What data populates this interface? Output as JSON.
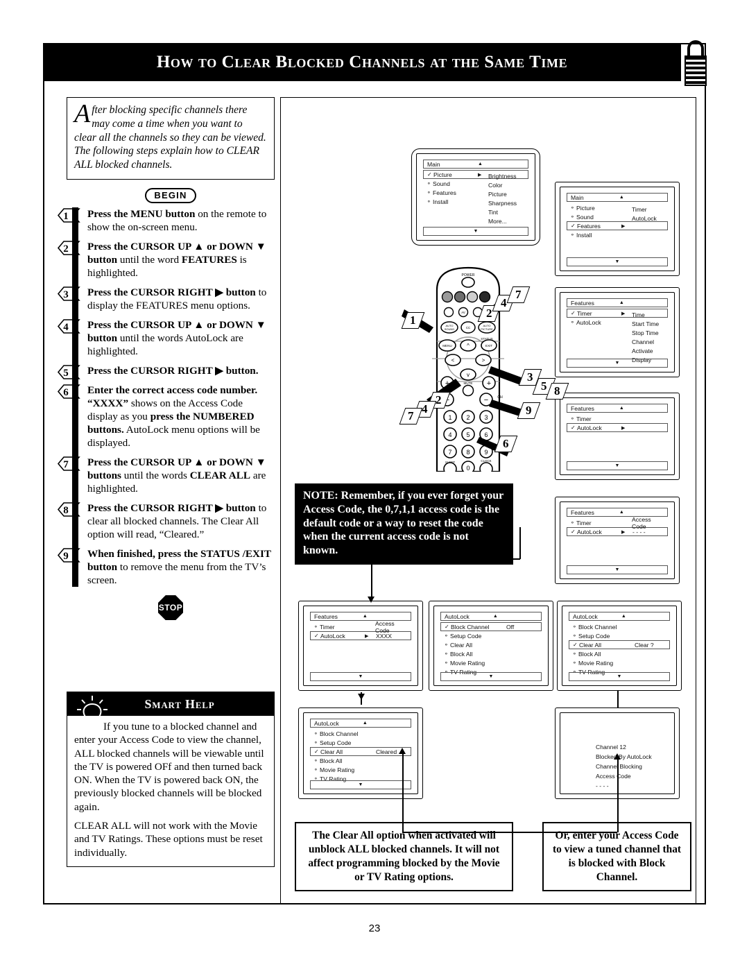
{
  "page": {
    "title": "How to Clear Blocked Channels at the Same Time",
    "number": "23",
    "padlock_icon": "open-padlock-icon"
  },
  "intro": {
    "dropcap": "A",
    "text": "fter blocking specific channels there may come a time when you want to clear all the channels so they can be viewed. The following steps explain how to CLEAR ALL blocked channels.",
    "begin_label": "BEGIN",
    "stop_label": "STOP"
  },
  "steps": [
    {
      "num": "1",
      "html": "<b>Press the MENU button</b> on the remote to show the on-screen menu."
    },
    {
      "num": "2",
      "html": "<b>Press the CURSOR UP ▲ or DOWN ▼ button</b> until the word <b>FEATURES</b> is highlighted."
    },
    {
      "num": "3",
      "html": "<b>Press the CURSOR RIGHT ▶ button</b> to display the FEATURES menu options."
    },
    {
      "num": "4",
      "html": "<b>Press the CURSOR UP ▲ or DOWN ▼ button</b> until the words AutoLock are highlighted."
    },
    {
      "num": "5",
      "html": "<b>Press the CURSOR RIGHT ▶ button.</b>"
    },
    {
      "num": "6",
      "html": "<b>Enter the correct access code number. “XXXX”</b> shows on the Access Code display as you <b>press the NUMBERED buttons.</b> AutoLock menu options will be displayed."
    },
    {
      "num": "7",
      "html": "<b>Press the CURSOR UP ▲ or DOWN ▼ buttons</b> until the words <b>CLEAR ALL</b> are highlighted."
    },
    {
      "num": "8",
      "html": "<b>Press the CURSOR RIGHT ▶ button</b> to clear all blocked channels. The Clear All option will read, “Cleared.”"
    },
    {
      "num": "9",
      "html": "<b>When finished, press the STATUS /EXIT button</b> to remove the menu from the TV’s screen."
    }
  ],
  "smart_help": {
    "title": "Smart Help",
    "icon": "lightbulb-icon",
    "paragraphs": [
      "If you tune to a blocked channel and enter your Access Code to view the channel, ALL blocked channels will be viewable until the TV is powered OFf and then turned back ON. When the TV is powered back ON, the previously blocked channels will be blocked again.",
      "CLEAR ALL will not work with the Movie and TV Ratings. These options must be reset individually."
    ]
  },
  "note": {
    "text": "NOTE: Remember, if you ever forget your Access Code, the 0,7,1,1 access code is the default code or a way to reset the code when the current access code is not known."
  },
  "captions": [
    {
      "text": "The Clear All option when activated will unblock ALL blocked channels. It will not affect programming blocked by the Movie or TV Rating options."
    },
    {
      "text": "Or, enter your Access Code to view a tuned channel that is blocked with Block Channel."
    }
  ],
  "screens": {
    "s1_main_picture": {
      "title": "Main",
      "rows": [
        {
          "bullet": "✓",
          "label": "Picture",
          "arrow": "▶",
          "boxed": true
        },
        {
          "bullet": "⚬",
          "label": "Sound",
          "arrow": "",
          "boxed": false
        },
        {
          "bullet": "⚬",
          "label": "Features",
          "arrow": "",
          "boxed": false
        },
        {
          "bullet": "⚬",
          "label": "Install",
          "arrow": "",
          "boxed": false
        }
      ],
      "column": [
        "Brightness",
        "Color",
        "Picture",
        "Sharpness",
        "Tint",
        "More..."
      ]
    },
    "s2_main_features": {
      "title": "Main",
      "rows": [
        {
          "bullet": "⚬",
          "label": "Picture",
          "arrow": "",
          "boxed": false
        },
        {
          "bullet": "⚬",
          "label": "Sound",
          "arrow": "",
          "boxed": false
        },
        {
          "bullet": "✓",
          "label": "Features",
          "arrow": "▶",
          "boxed": true
        },
        {
          "bullet": "⚬",
          "label": "Install",
          "arrow": "",
          "boxed": false
        }
      ],
      "column": [
        "Timer",
        "AutoLock"
      ]
    },
    "s3_features_timer": {
      "title": "Features",
      "rows": [
        {
          "bullet": "✓",
          "label": "Timer",
          "arrow": "▶",
          "boxed": true
        },
        {
          "bullet": "⚬",
          "label": "AutoLock",
          "arrow": "",
          "boxed": false
        }
      ],
      "column": [
        "Time",
        "Start Time",
        "Stop Time",
        "Channel",
        "Activate",
        "Display"
      ]
    },
    "s4_features_autolock": {
      "title": "Features",
      "rows": [
        {
          "bullet": "⚬",
          "label": "Timer",
          "arrow": "",
          "boxed": false
        },
        {
          "bullet": "✓",
          "label": "AutoLock",
          "arrow": "▶",
          "boxed": true
        }
      ],
      "column": []
    },
    "s5_access_code_blank": {
      "title": "Features",
      "rows": [
        {
          "bullet": "⚬",
          "label": "Timer",
          "arrow": "",
          "value": "Access Code",
          "boxed": false
        },
        {
          "bullet": "✓",
          "label": "AutoLock",
          "arrow": "▶",
          "value": "- - - -",
          "boxed": true
        }
      ],
      "column": []
    },
    "s6_access_code_xxxx": {
      "title": "Features",
      "rows": [
        {
          "bullet": "⚬",
          "label": "Timer",
          "arrow": "",
          "value": "Access Code",
          "boxed": false
        },
        {
          "bullet": "✓",
          "label": "AutoLock",
          "arrow": "▶",
          "value": "XXXX",
          "boxed": true
        }
      ],
      "column": []
    },
    "s7_autolock_block_channel": {
      "title": "AutoLock",
      "rows": [
        {
          "bullet": "✓",
          "label": "Block Channel",
          "arrow": "",
          "value": "Off",
          "boxed": true
        },
        {
          "bullet": "⚬",
          "label": "Setup Code",
          "arrow": "",
          "boxed": false
        },
        {
          "bullet": "⚬",
          "label": "Clear All",
          "arrow": "",
          "boxed": false
        },
        {
          "bullet": "⚬",
          "label": "Block All",
          "arrow": "",
          "boxed": false
        },
        {
          "bullet": "⚬",
          "label": "Movie Rating",
          "arrow": "",
          "boxed": false
        },
        {
          "bullet": "⚬",
          "label": "TV Rating",
          "arrow": "",
          "boxed": false
        }
      ],
      "column": []
    },
    "s8_autolock_clear_q": {
      "title": "AutoLock",
      "rows": [
        {
          "bullet": "⚬",
          "label": "Block Channel",
          "arrow": "",
          "boxed": false
        },
        {
          "bullet": "⚬",
          "label": "Setup Code",
          "arrow": "",
          "boxed": false
        },
        {
          "bullet": "✓",
          "label": "Clear All",
          "arrow": "",
          "value": "Clear ?",
          "boxed": true
        },
        {
          "bullet": "⚬",
          "label": "Block All",
          "arrow": "",
          "boxed": false
        },
        {
          "bullet": "⚬",
          "label": "Movie Rating",
          "arrow": "",
          "boxed": false
        },
        {
          "bullet": "⚬",
          "label": "TV Rating",
          "arrow": "",
          "boxed": false
        }
      ],
      "column": []
    },
    "s9_autolock_cleared": {
      "title": "AutoLock",
      "rows": [
        {
          "bullet": "⚬",
          "label": "Block Channel",
          "arrow": "",
          "boxed": false
        },
        {
          "bullet": "⚬",
          "label": "Setup Code",
          "arrow": "",
          "boxed": false
        },
        {
          "bullet": "✓",
          "label": "Clear All",
          "arrow": "",
          "value": "Cleared",
          "boxed": true
        },
        {
          "bullet": "⚬",
          "label": "Block All",
          "arrow": "",
          "boxed": false
        },
        {
          "bullet": "⚬",
          "label": "Movie Rating",
          "arrow": "",
          "boxed": false
        },
        {
          "bullet": "⚬",
          "label": "TV Rating",
          "arrow": "",
          "boxed": false
        }
      ],
      "column": []
    },
    "s10_blocked_channel": {
      "lines": [
        "Channel 12",
        "Blocked By AutoLock",
        "Channel Blocking",
        "Access Code",
        "- - - -"
      ]
    }
  },
  "remote": {
    "labels": {
      "power": "POWER",
      "menu": "MENU",
      "status_exit_top": "STATUS",
      "exit": "EXIT",
      "auto_sound": "AUTO SOUND",
      "cc": "CC",
      "auto_picture": "AUTO PICTURE",
      "av": "AV",
      "mute": "MUTE",
      "ch": "CH",
      "sleep": "SLEEP",
      "clock": "CLOCK"
    },
    "keypad": [
      "1",
      "2",
      "3",
      "4",
      "5",
      "6",
      "7",
      "8",
      "9",
      "0"
    ],
    "callouts": [
      "1",
      "2",
      "3",
      "4",
      "5",
      "6",
      "7",
      "8",
      "9"
    ]
  }
}
